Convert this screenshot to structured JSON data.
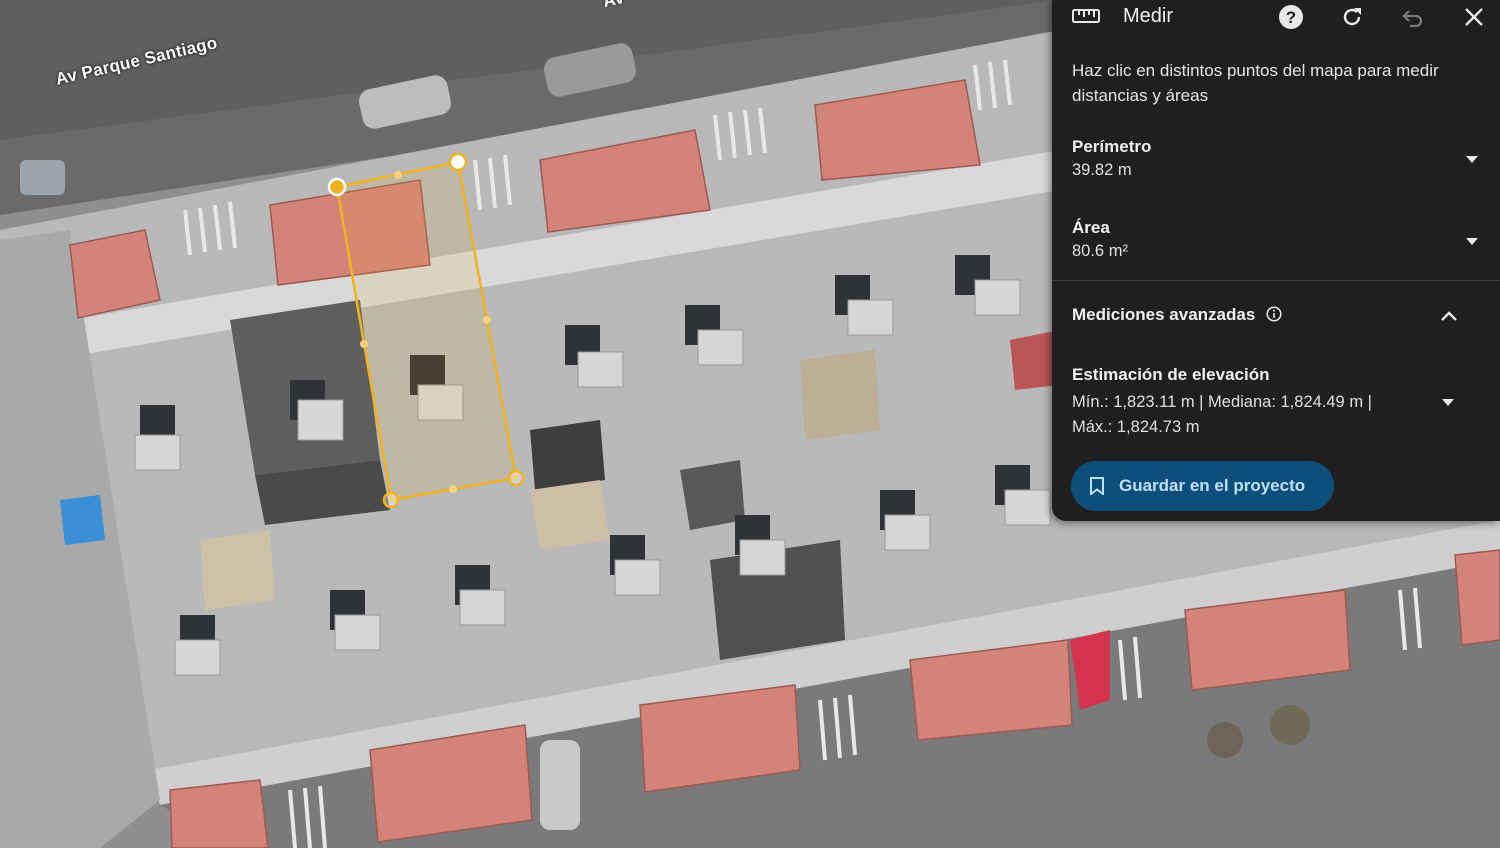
{
  "map": {
    "street_label": "Av Parque Santiago",
    "top_partial_label": "Av"
  },
  "panel": {
    "title": "Medir",
    "instruction": "Haz clic en distintos puntos del mapa para medir distancias y áreas",
    "perimeter": {
      "label": "Perímetro",
      "value": "39.82 m"
    },
    "area": {
      "label": "Área",
      "value": "80.6 m²"
    },
    "advanced": {
      "label": "Mediciones avanzadas"
    },
    "elevation": {
      "label": "Estimación de elevación",
      "value": "Mín.: 1,823.11 m | Mediana: 1,824.49 m | Máx.: 1,824.73 m"
    },
    "save_button": "Guardar en el proyecto"
  },
  "colors": {
    "panel_bg": "#1f1f1f",
    "save_button_bg": "#0d4e7a",
    "save_button_text": "#bfe0fb",
    "measure_line": "#f2b31e",
    "roof_tile": "#d4837a"
  }
}
